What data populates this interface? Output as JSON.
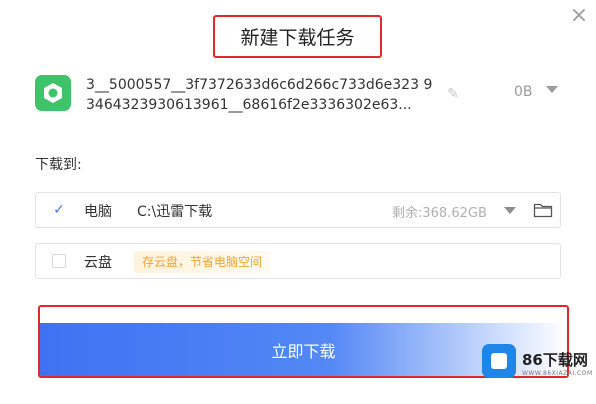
{
  "dialog": {
    "title": "新建下载任务",
    "close_glyph": "×"
  },
  "file": {
    "icon": "android-app-icon",
    "name": "3__5000557__3f7372633d6c6d266c733d6e323 93464323930613961__68616f2e3336302e63...",
    "size": "0B",
    "edit_icon": "pencil-icon"
  },
  "download_to": {
    "label": "下载到:",
    "pc": {
      "label": "电脑",
      "path": "C:\\迅雷下载",
      "free_space": "剩余:368.62GB",
      "checked": true
    },
    "cloud": {
      "label": "云盘",
      "tag": "存云盘，节省电脑空间",
      "checked": false
    }
  },
  "actions": {
    "download_now": "立即下载"
  },
  "watermark": {
    "brand": "86下载网",
    "sub": "WWW.86XIAZAI.COM"
  },
  "colors": {
    "accent_blue": "#3e72f2",
    "highlight_red": "#e02a2a",
    "app_icon_green": "#3ec36a",
    "tag_orange": "#f2a431"
  }
}
